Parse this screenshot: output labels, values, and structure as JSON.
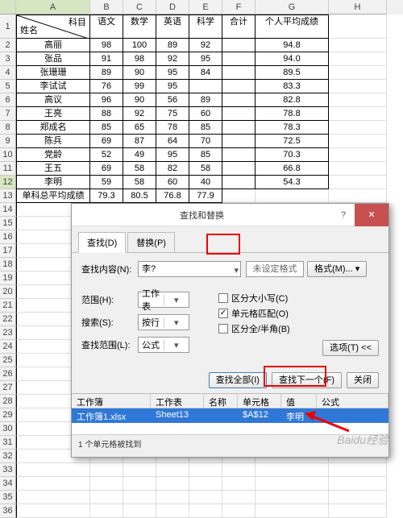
{
  "columns": [
    "",
    "A",
    "B",
    "C",
    "D",
    "E",
    "F",
    "G",
    "H"
  ],
  "hdr": {
    "subject": "科目",
    "name": "姓名",
    "b": "语文",
    "c": "数学",
    "d": "英语",
    "e": "科学",
    "f": "合计",
    "g": "个人平均成绩"
  },
  "rows": [
    {
      "n": "高丽",
      "b": "98",
      "c": "100",
      "d": "89",
      "e": "92",
      "g": "94.8"
    },
    {
      "n": "张品",
      "b": "91",
      "c": "98",
      "d": "92",
      "e": "95",
      "g": "94.0"
    },
    {
      "n": "张珊珊",
      "b": "89",
      "c": "90",
      "d": "95",
      "e": "84",
      "g": "89.5"
    },
    {
      "n": "李试试",
      "b": "76",
      "c": "99",
      "d": "95",
      "e": "",
      "g": "83.3"
    },
    {
      "n": "高议",
      "b": "96",
      "c": "90",
      "d": "56",
      "e": "89",
      "g": "82.8"
    },
    {
      "n": "王亮",
      "b": "88",
      "c": "92",
      "d": "75",
      "e": "60",
      "g": "78.8"
    },
    {
      "n": "郑成名",
      "b": "85",
      "c": "65",
      "d": "78",
      "e": "85",
      "g": "78.3"
    },
    {
      "n": "陈兵",
      "b": "69",
      "c": "87",
      "d": "64",
      "e": "70",
      "g": "72.5"
    },
    {
      "n": "党龄",
      "b": "52",
      "c": "49",
      "d": "95",
      "e": "85",
      "g": "70.3"
    },
    {
      "n": "王五",
      "b": "69",
      "c": "58",
      "d": "82",
      "e": "58",
      "g": "66.8"
    },
    {
      "n": "李明",
      "b": "59",
      "c": "58",
      "d": "60",
      "e": "40",
      "g": "54.3"
    }
  ],
  "footer": {
    "label": "单科总平均成绩",
    "b": "79.3",
    "c": "80.5",
    "d": "76.8",
    "e": "77.9"
  },
  "dialog": {
    "title": "查找和替换",
    "tab_find": "查找(D)",
    "tab_replace": "替换(P)",
    "find_label": "查找内容(N):",
    "find_value": "李?",
    "no_format": "未设定格式",
    "format_btn": "格式(M)...",
    "scope_label": "范围(H):",
    "scope_value": "工作表",
    "search_label": "搜索(S):",
    "search_value": "按行",
    "lookin_label": "查找范围(L):",
    "lookin_value": "公式",
    "chk_case": "区分大小写(C)",
    "chk_whole": "单元格匹配(O)",
    "chk_width": "区分全/半角(B)",
    "options_btn": "选项(T) <<",
    "find_all": "查找全部(I)",
    "find_next": "查找下一个(F)",
    "close": "关闭",
    "res_hdr": {
      "book": "工作簿",
      "sheet": "工作表",
      "name": "名称",
      "cell": "单元格",
      "value": "值",
      "formula": "公式"
    },
    "res_row": {
      "book": "工作簿1.xlsx",
      "sheet": "Sheet13",
      "name": "",
      "cell": "$A$12",
      "value": "李明"
    },
    "status": "1 个单元格被找到"
  },
  "watermark": "Baidu经验"
}
